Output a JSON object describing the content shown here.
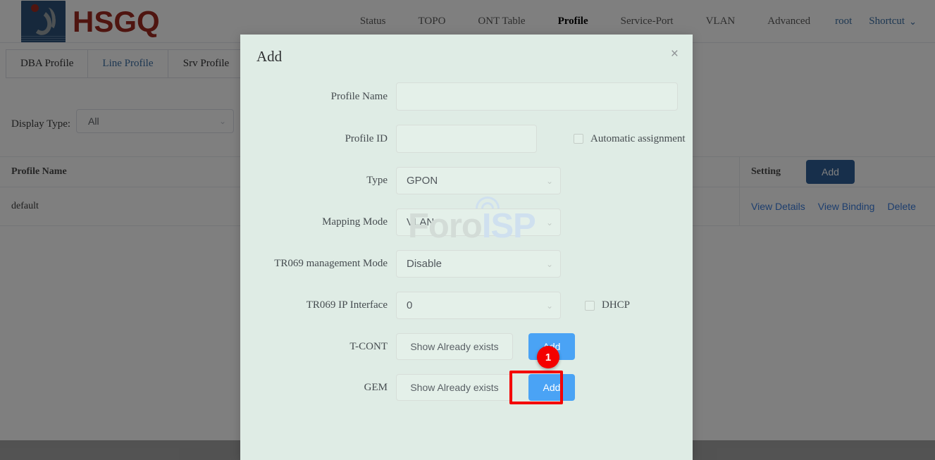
{
  "brand": {
    "logo_text": "HSGQ",
    "logo_icon": "hsgq-logo-icon"
  },
  "nav": {
    "items": [
      {
        "label": "Status",
        "active": false
      },
      {
        "label": "TOPO",
        "active": false
      },
      {
        "label": "ONT Table",
        "active": false
      },
      {
        "label": "Profile",
        "active": true
      },
      {
        "label": "Service-Port",
        "active": false
      },
      {
        "label": "VLAN",
        "active": false
      },
      {
        "label": "Advanced",
        "active": false
      }
    ],
    "user": "root",
    "shortcut": "Shortcut",
    "caret": "⌄"
  },
  "tabs": [
    {
      "label": "DBA Profile",
      "active": false
    },
    {
      "label": "Line Profile",
      "active": true
    },
    {
      "label": "Srv Profile",
      "active": false
    }
  ],
  "filter": {
    "label": "Display Type:",
    "value": "All",
    "caret": "⌄"
  },
  "table": {
    "headers": {
      "profile_name": "Profile Name",
      "setting": "Setting"
    },
    "add_button": "Add",
    "rows": [
      {
        "profile_name": "default",
        "actions": [
          "View Details",
          "View Binding",
          "Delete"
        ]
      }
    ]
  },
  "dialog": {
    "title": "Add",
    "close_icon": "×",
    "fields": {
      "profile_name": {
        "label": "Profile Name",
        "value": "",
        "placeholder": ""
      },
      "profile_id": {
        "label": "Profile ID",
        "value": "",
        "placeholder": ""
      },
      "automatic_assignment": {
        "label": "Automatic assignment",
        "checked": false
      },
      "type": {
        "label": "Type",
        "value": "GPON"
      },
      "mapping_mode": {
        "label": "Mapping Mode",
        "value": "VLAN"
      },
      "tr069_management_mode": {
        "label": "TR069 management Mode",
        "value": "Disable"
      },
      "tr069_ip_interface": {
        "label": "TR069 IP Interface",
        "value": "0"
      },
      "dhcp": {
        "label": "DHCP",
        "checked": false
      },
      "tcont": {
        "label": "T-CONT",
        "show_button": "Show Already exists",
        "add_button": "Add"
      },
      "gem": {
        "label": "GEM",
        "show_button": "Show Already exists",
        "add_button": "Add"
      }
    },
    "caret": "⌄"
  },
  "annotation": {
    "badge_number": "1",
    "target": "gem-add-button",
    "box_color": "#f40000"
  },
  "watermark": {
    "part1": "Foro",
    "part2": "ISP"
  },
  "colors": {
    "brand_red": "#9e2b20",
    "brand_blue": "#2d5178",
    "link_blue": "#3b7ddd",
    "primary_button": "#4aa3f5",
    "table_button": "#2f5f96",
    "dialog_bg": "#dfece5",
    "annotation_red": "#f40000"
  }
}
